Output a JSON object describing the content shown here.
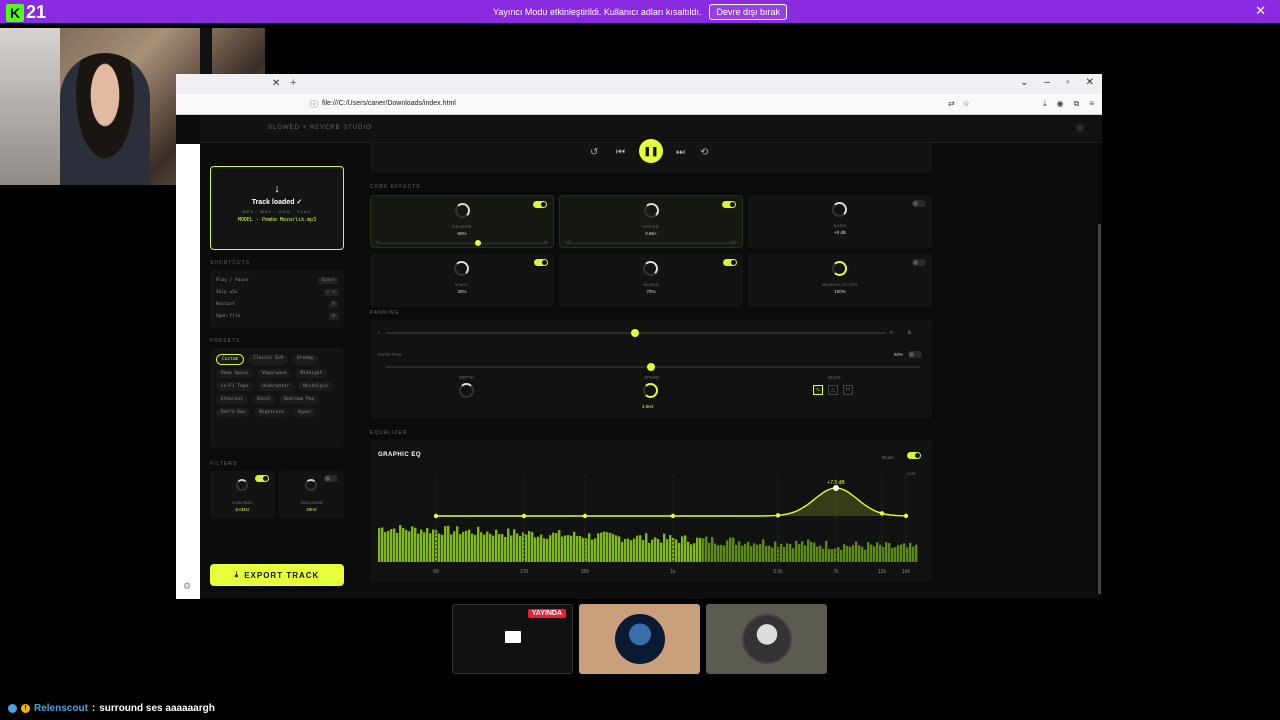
{
  "banner": {
    "logo_letter": "K",
    "logo_number": "21",
    "message": "Yayıncı Modu etkinleştirildi. Kullanıcı adları kısaltıldı.",
    "button": "Devre dışı bırak",
    "close": "✕"
  },
  "browser": {
    "url": "file:///C:/Users/caner/Downloads/index.html",
    "tab_close": "✕",
    "new_tab": "+"
  },
  "app": {
    "brand": "SLOWED + REVERB STUDIO",
    "loaded": {
      "arrow": "↓",
      "title": "Track loaded ✓",
      "formats": "MP3 · WAV · OGG · FLAC",
      "file": "MODEL - Pembe Mezarlık.mp3"
    },
    "shortcuts_label": "SHORTCUTS",
    "shortcuts": [
      {
        "action": "Play / Pause",
        "key": "Space"
      },
      {
        "action": "Skip ±5s",
        "key": "← →"
      },
      {
        "action": "Restart",
        "key": "R"
      },
      {
        "action": "Open file",
        "key": "O"
      }
    ],
    "presets_label": "PRESETS",
    "presets": [
      "Custom",
      "Classic S+R",
      "Dreamy",
      "Deep Space",
      "Vaporwave",
      "Midnight",
      "Lo-Fi Tape",
      "Underwater",
      "Nostalgia",
      "Ethereal",
      "Ghost",
      "Bedroom Pop",
      "Retro Rav",
      "Nightcore",
      "Hyper"
    ],
    "filters_label": "FILTERS",
    "filters": [
      {
        "name": "LOW-PASS",
        "value": "6.0kHz"
      },
      {
        "name": "HIGH-PASS",
        "value": "40Hz"
      }
    ],
    "export": "EXPORT TRACK",
    "core_label": "CORE EFFECTS",
    "effects": [
      {
        "name": "REVERB",
        "value": "60%",
        "min": "0s",
        "max": "8s"
      },
      {
        "name": "SPEED",
        "value": "0.85×",
        "min": "0.5×",
        "max": "1.5×"
      },
      {
        "name": "BASS",
        "value": "+0 dB"
      },
      {
        "name": "VINYL",
        "value": "25%"
      },
      {
        "name": "WIDEN",
        "value": "70%"
      },
      {
        "name": "WOW/FLUTTER",
        "value": "100%"
      }
    ],
    "panning_label": "PANNING",
    "pan_left": "L",
    "pan_right": "R",
    "pan_value": "C",
    "autopan_label": "AUTO-PAN",
    "autopan_value": "50%",
    "depth_label": "DEPTH",
    "speed_label": "SPEED",
    "speed_value": "4.0Hz",
    "wave_label": "WAVE",
    "eq_label": "EQUALIZER",
    "eq_title": "GRAPHIC EQ",
    "eq_reset": "Reset",
    "eq_live": "LIVE",
    "eq_peak": "+7.5 dB",
    "eq_freqs": [
      "60",
      "170",
      "350",
      "1k",
      "3.5k",
      "7k",
      "12k",
      "16k"
    ]
  },
  "stream": {
    "live_badge": "YAYINDA"
  },
  "chat": {
    "user": "Relenscout",
    "separator": ":",
    "message": "surround ses aaaaaargh"
  },
  "colors": {
    "accent": "#e5ff3a",
    "banner": "#8a2be2"
  }
}
